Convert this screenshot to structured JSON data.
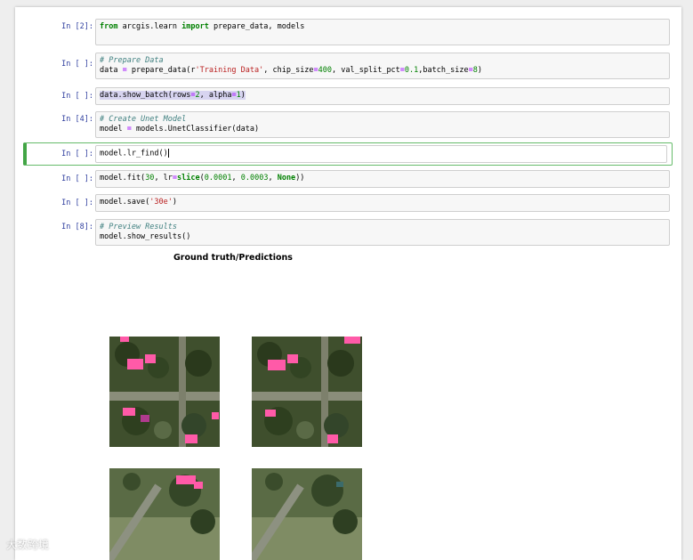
{
  "cells": [
    {
      "prompt": "In [2]:",
      "line1": {
        "kw1": "from",
        "t1": " arcgis.learn ",
        "kw2": "import",
        "t2": " prepare_data, models"
      }
    },
    {
      "prompt": "In [ ]:",
      "comment": "# Prepare Data",
      "code": {
        "a": "data ",
        "eq": "=",
        "b": " prepare_data(r",
        "s": "'Training Data'",
        "c": ", chip_size",
        "eq2": "=",
        "n1": "400",
        "d": ", val_split_pct",
        "eq3": "=",
        "n2": "0.1",
        "e": ",batch_size",
        "eq4": "=",
        "n3": "8",
        "f": ")"
      }
    },
    {
      "prompt": "In [ ]:",
      "code": {
        "a": "data.show_batch(rows",
        "eq": "=",
        "n1": "2",
        "b": ", alpha",
        "eq2": "=",
        "n2": "1",
        "c": ")"
      }
    },
    {
      "prompt": "In [4]:",
      "comment": "# Create Unet Model",
      "code": {
        "a": "model ",
        "eq": "=",
        "b": " models.UnetClassifier(data)"
      }
    },
    {
      "prompt": "In [ ]:",
      "code": {
        "a": "model.lr_find()"
      }
    },
    {
      "prompt": "In [ ]:",
      "code": {
        "a": "model.fit(",
        "n1": "30",
        "b": ", lr",
        "eq": "=",
        "kw": "slice",
        "c": "(",
        "n2": "0.0001",
        "d": ", ",
        "n3": "0.0003",
        "e": ", ",
        "kw2": "None",
        "f": "))"
      }
    },
    {
      "prompt": "In [ ]:",
      "code": {
        "a": "model.save(",
        "s": "'30e'",
        "b": ")"
      }
    },
    {
      "prompt": "In [8]:",
      "comment": "# Preview Results",
      "code": {
        "a": "model.show_results()"
      }
    }
  ],
  "output": {
    "title": "Ground truth/Predictions"
  },
  "watermark": "大数跨境",
  "colors": {
    "prompt": "#303f9f",
    "selected": "#42a545",
    "mask": "#ff5aa8"
  }
}
